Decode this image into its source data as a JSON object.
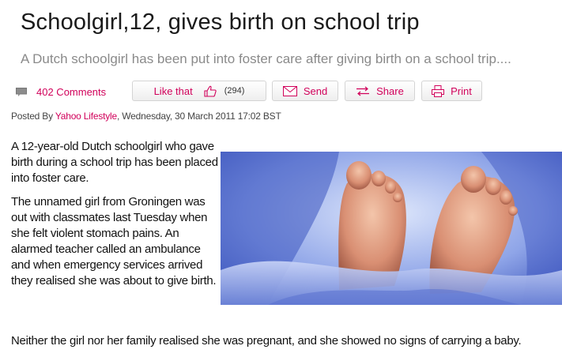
{
  "article": {
    "headline": "Schoolgirl,12, gives birth on school trip",
    "standfirst": "A Dutch schoolgirl has been put into foster care  after giving birth on a school trip....",
    "byline": {
      "prefix": "Posted By ",
      "source": "Yahoo Lifestyle",
      "date": ", Wednesday, 30 March 2011 17:02 BST"
    },
    "paragraphs": [
      "A 12-year-old Dutch schoolgirl who gave birth during a school trip has been placed into foster care.",
      "The unnamed girl from Groningen was out with classmates last Tuesday when she felt violent stomach pains. An alarmed teacher called an ambulance and when emergency services arrived they realised she was about to give birth.",
      "Neither the girl nor her family realised she was pregnant, and she showed no signs of carrying a baby."
    ]
  },
  "toolbar": {
    "comments_label": "402 Comments",
    "like_label": "Like that",
    "like_count": "(294)",
    "send_label": "Send",
    "share_label": "Share",
    "print_label": "Print"
  },
  "icons": {
    "comments": "speech-bubble-icon",
    "like": "thumbs-up-icon",
    "send": "envelope-icon",
    "share": "share-arrows-icon",
    "print": "printer-icon"
  },
  "colors": {
    "accent": "#d1005a",
    "headline": "#1a1a1a",
    "standfirst": "#8a8a8a"
  }
}
